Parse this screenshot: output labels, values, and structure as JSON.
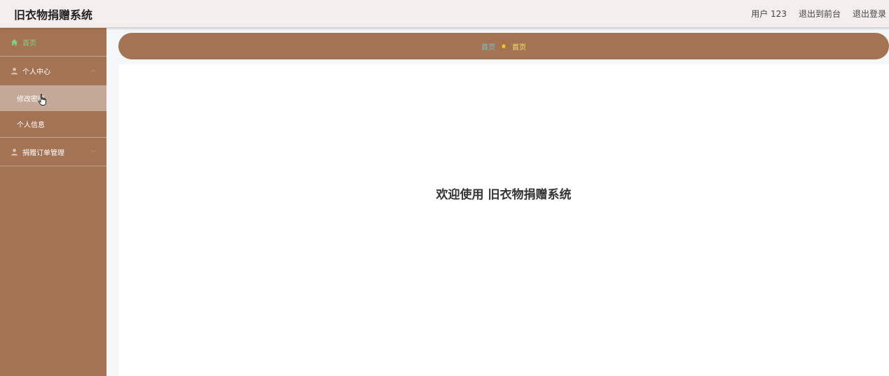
{
  "header": {
    "app_title": "旧衣物捐赠系统",
    "user_label": "用户 123",
    "to_front": "退出到前台",
    "logout": "退出登录"
  },
  "sidebar": {
    "home": {
      "label": "首页",
      "icon": "home-icon"
    },
    "personal_center": {
      "label": "个人中心",
      "icon": "user-icon",
      "children": [
        {
          "label": "修改密码"
        },
        {
          "label": "个人信息"
        }
      ]
    },
    "donation_orders": {
      "label": "捐赠订单管理",
      "icon": "user-icon"
    }
  },
  "breadcrumb": {
    "home": "首页",
    "current": "首页"
  },
  "main": {
    "welcome": "欢迎使用 旧衣物捐赠系统"
  },
  "colors": {
    "sidebar_bg": "#a47353",
    "active_sub": "#c4a898",
    "topbar_bg": "#f5eeee"
  }
}
